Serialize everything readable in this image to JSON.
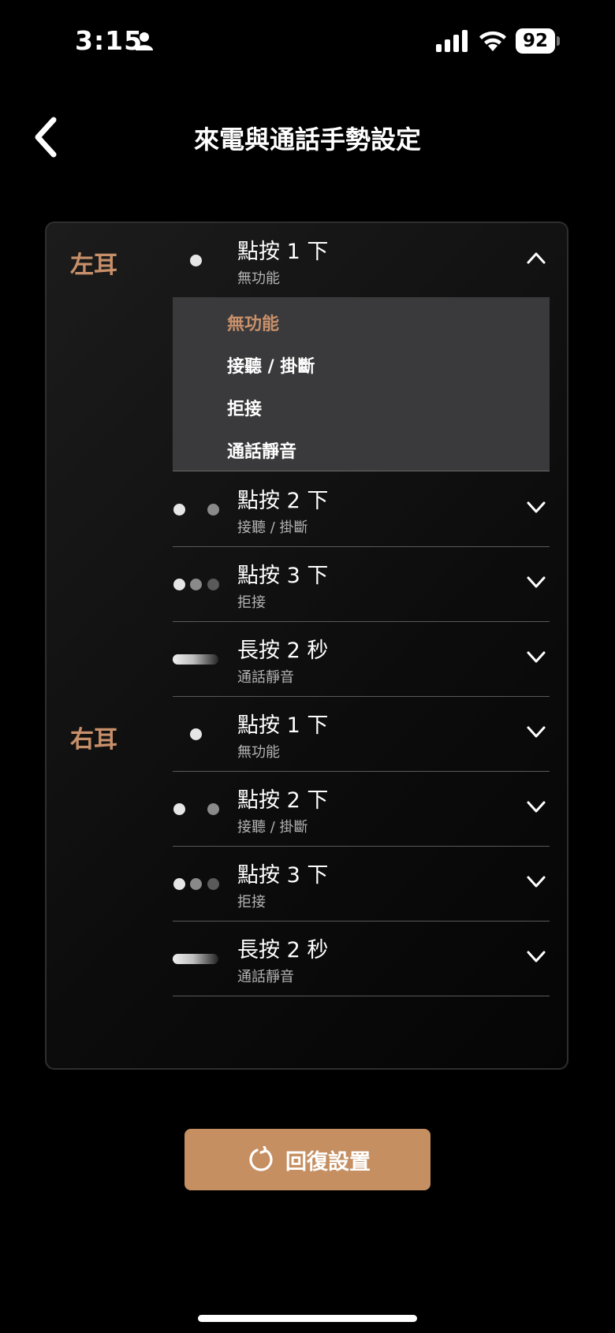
{
  "status_bar": {
    "time": "3:15",
    "battery": "92"
  },
  "header": {
    "title": "來電與通話手勢設定"
  },
  "ears": [
    {
      "label": "左耳",
      "gestures": [
        {
          "title": "點按 1 下",
          "value": "無功能",
          "expanded": true
        },
        {
          "title": "點按 2 下",
          "value": "接聽 / 掛斷",
          "expanded": false
        },
        {
          "title": "點按 3 下",
          "value": "拒接",
          "expanded": false
        },
        {
          "title": "長按 2 秒",
          "value": "通話靜音",
          "expanded": false
        }
      ]
    },
    {
      "label": "右耳",
      "gestures": [
        {
          "title": "點按 1 下",
          "value": "無功能",
          "expanded": false
        },
        {
          "title": "點按 2 下",
          "value": "接聽 / 掛斷",
          "expanded": false
        },
        {
          "title": "點按 3 下",
          "value": "拒接",
          "expanded": false
        },
        {
          "title": "長按 2 秒",
          "value": "通話靜音",
          "expanded": false
        }
      ]
    }
  ],
  "dropdown": {
    "options": [
      "無功能",
      "接聽 / 掛斷",
      "拒接",
      "通話靜音"
    ],
    "selected": "無功能"
  },
  "reset_button": {
    "label": "回復設置"
  },
  "colors": {
    "accent": "#c8906a",
    "button": "#c58f62",
    "dropdown_bg": "#3a3a3c"
  }
}
